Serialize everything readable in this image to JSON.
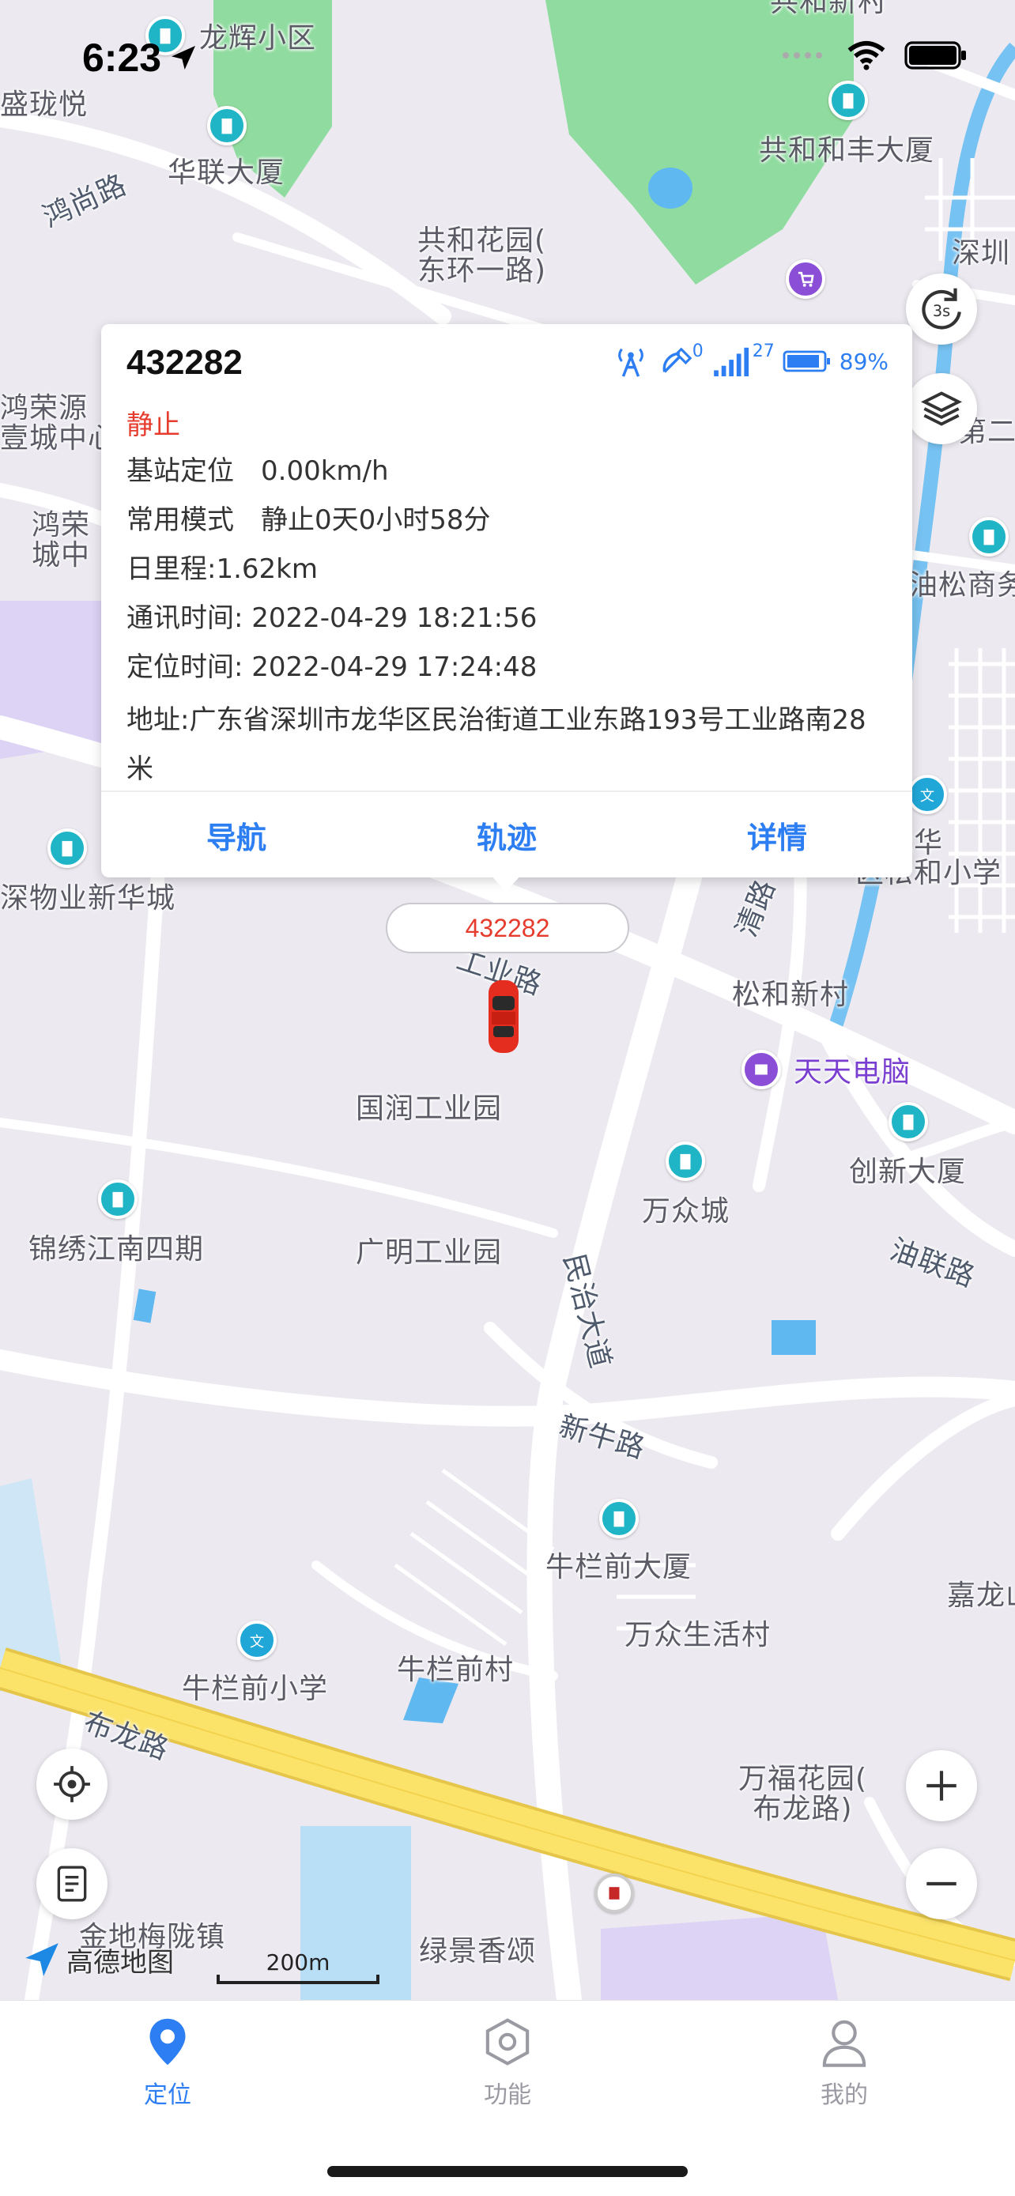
{
  "status_bar": {
    "time": "6:23"
  },
  "map": {
    "labels": {
      "longhui": "龙辉小区",
      "shenglong": "盛珑悦",
      "gonghe_new": "共和新村",
      "gonghe_hefeng": "共和和丰大厦",
      "hualian": "华联大厦",
      "hongshang_road": "鸿尚路",
      "gonghe_garden": "共和花园(\n东环一路)",
      "shenzhen_top": "深圳",
      "hongrongyuan": "鸿荣源\n壹城中心",
      "hongrong2": "鸿荣\n城中",
      "second": "第二",
      "yousong": "油松商务",
      "mingzhi_school": "市龙华\n区松和小学",
      "wuye": "深物业新华城",
      "gongye_road": "工业路",
      "qing_road": "清路",
      "songhe": "松和新村",
      "tiantian": "天天电脑",
      "guorun": "国润工业园",
      "chuangxin": "创新大厦",
      "jinxiu": "锦绣江南四期",
      "wanzhong": "万众城",
      "guangming": "广明工业园",
      "minzhi_road": "民治大道",
      "youlian_road": "油联路",
      "xinniu_road": "新牛路",
      "niulanqian_building": "牛栏前大厦",
      "jialong": "嘉龙山",
      "wanzhong_life": "万众生活村",
      "niulanqian_school": "牛栏前小学",
      "niulanqian_village": "牛栏前村",
      "bulong_road": "布龙路",
      "wanfu": "万福花园(\n布龙路)",
      "jindi": "金地梅陇镇",
      "lvjing": "绿景香颂",
      "amap": "高德地图",
      "scale": "200m",
      "refresh": "3s"
    }
  },
  "popup": {
    "title": "432282",
    "sat_count": "0",
    "signal_count": "27",
    "battery": "89%",
    "status": "静止",
    "rows": [
      {
        "label": "基站定位",
        "value": "0.00km/h"
      },
      {
        "label": "常用模式",
        "value": "静止0天0小时58分"
      },
      {
        "label": "日里程:1.62km",
        "value": ""
      },
      {
        "label": "通讯时间: 2022-04-29 18:21:56",
        "value": ""
      },
      {
        "label": "定位时间: 2022-04-29 17:24:48",
        "value": ""
      }
    ],
    "address": "地址:广东省深圳市龙华区民治街道工业东路193号工业路南28米",
    "actions": {
      "navigate": "导航",
      "track": "轨迹",
      "detail": "详情"
    }
  },
  "vehicle_label": "432282",
  "tabs": [
    {
      "label": "定位",
      "active": true
    },
    {
      "label": "功能",
      "active": false
    },
    {
      "label": "我的",
      "active": false
    }
  ],
  "colors": {
    "accent": "#2d7ef2",
    "alert": "#e63c2e",
    "green_area": "#8fdc9c",
    "water": "#5fb8f0",
    "highway": "#fbe36a"
  }
}
